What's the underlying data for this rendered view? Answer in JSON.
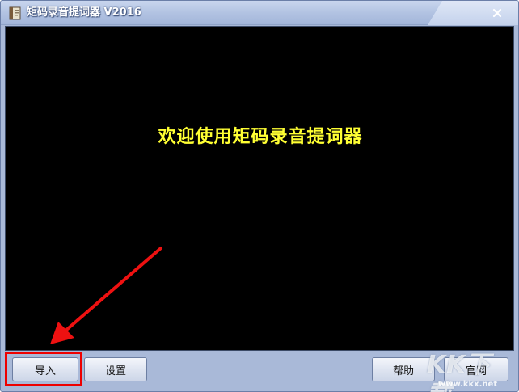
{
  "window": {
    "title": "矩码录音提词器 V2016",
    "app_icon": "notebook-icon",
    "close_icon": "close-icon"
  },
  "display": {
    "welcome_text": "欢迎使用矩码录音提词器",
    "text_color": "#ffff33",
    "background_color": "#000000"
  },
  "toolbar": {
    "import_label": "导入",
    "settings_label": "设置",
    "help_label": "帮助",
    "website_label": "官网"
  },
  "annotation": {
    "highlight_color": "#ee0000",
    "arrow_icon": "red-arrow-icon"
  },
  "watermark": {
    "logo_text": "KK下载",
    "url": "www.kkx.net"
  }
}
